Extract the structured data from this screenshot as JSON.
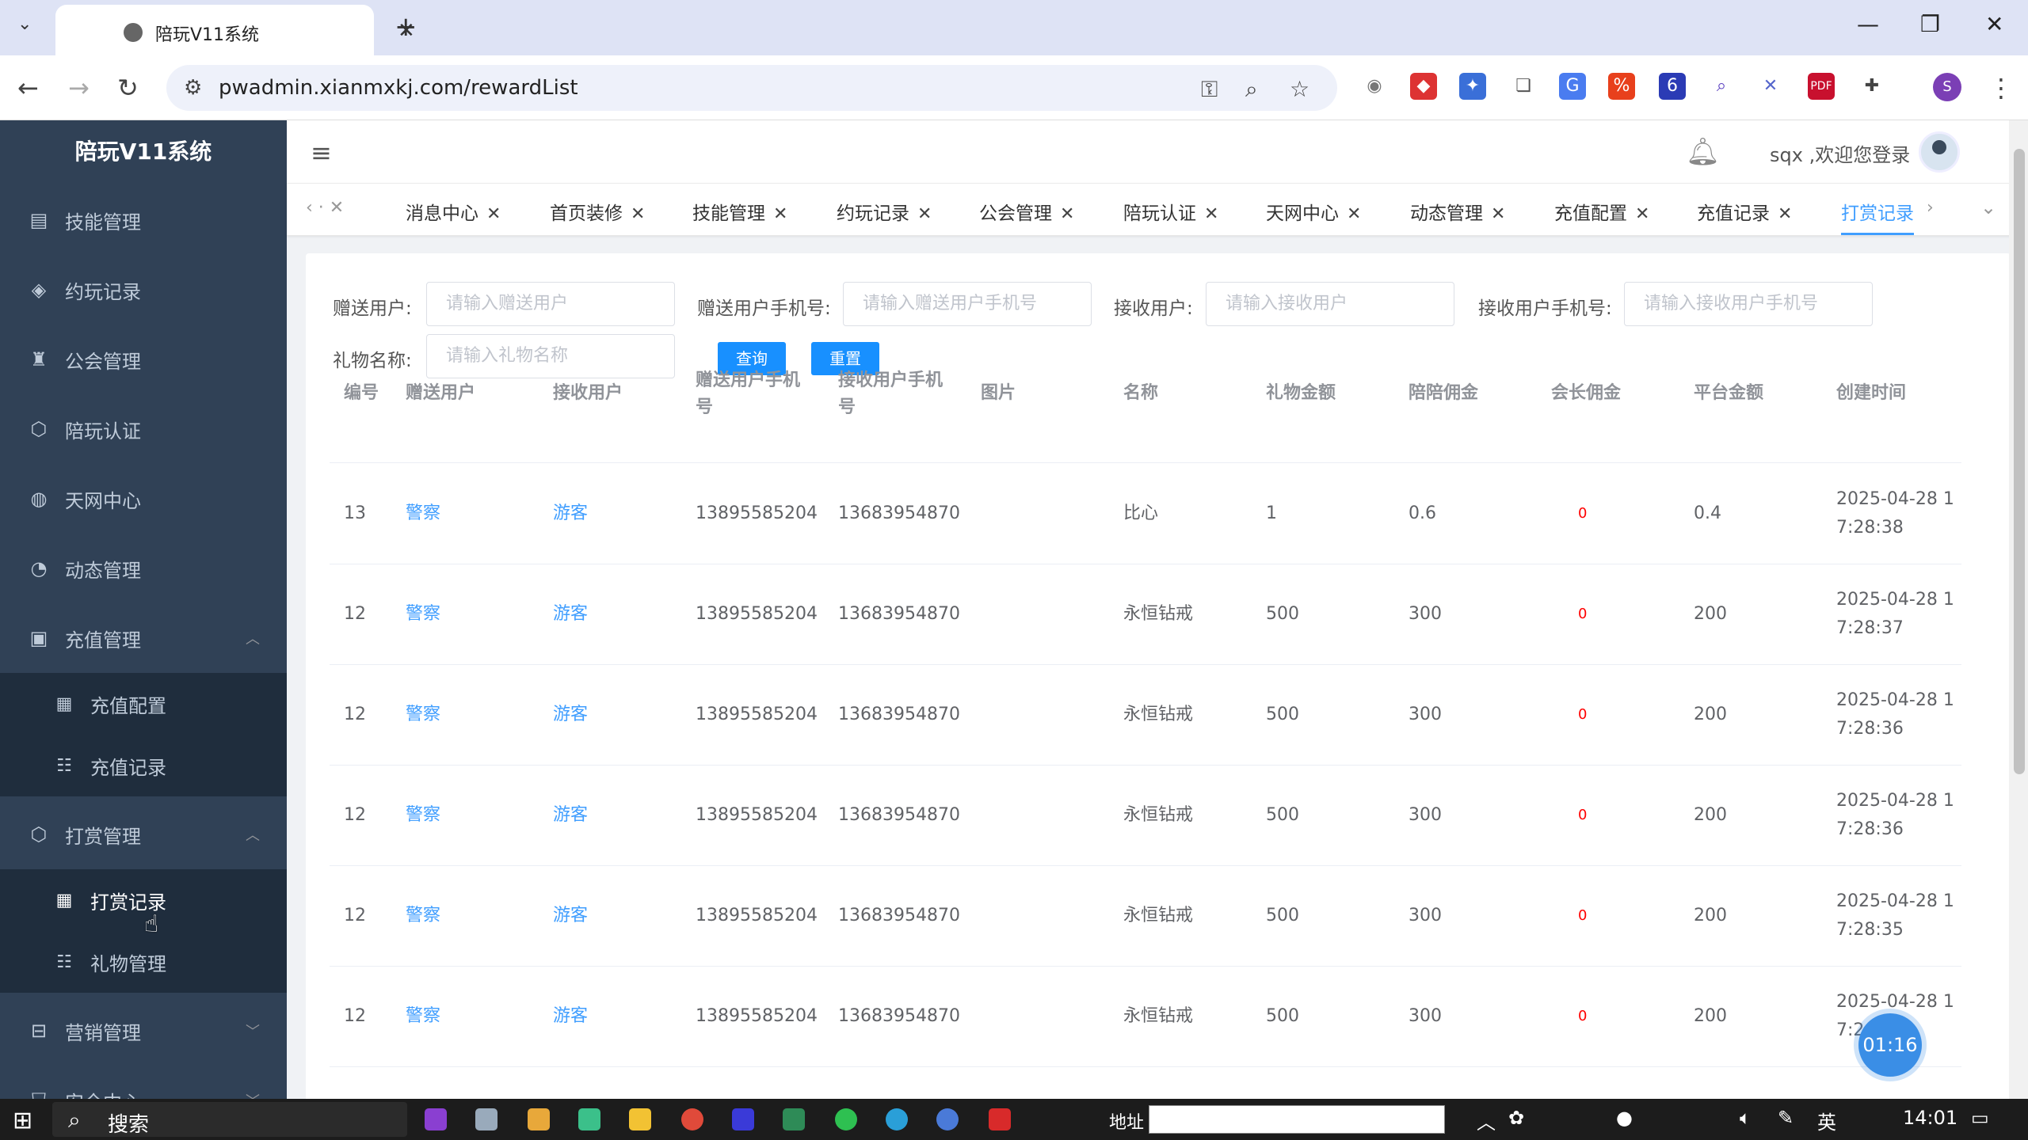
{
  "browser": {
    "tab_title": "陪玩V11系统",
    "url": "pwadmin.xianmxkj.com/rewardList"
  },
  "sidebar": {
    "brand": "陪玩V11系统",
    "items": [
      {
        "label": "技能管理",
        "icon": "clipboard-icon"
      },
      {
        "label": "约玩记录",
        "icon": "layers-icon"
      },
      {
        "label": "公会管理",
        "icon": "user-group-icon"
      },
      {
        "label": "陪玩认证",
        "icon": "box-icon"
      },
      {
        "label": "天网中心",
        "icon": "globe-icon"
      },
      {
        "label": "动态管理",
        "icon": "pie-chart-icon"
      },
      {
        "label": "充值管理",
        "icon": "wallet-icon"
      },
      {
        "label": "充值配置",
        "icon": "table-icon"
      },
      {
        "label": "充值记录",
        "icon": "list-icon"
      },
      {
        "label": "打赏管理",
        "icon": "box-icon"
      },
      {
        "label": "打赏记录",
        "icon": "table-icon"
      },
      {
        "label": "礼物管理",
        "icon": "list-icon"
      },
      {
        "label": "营销管理",
        "icon": "bag-icon"
      },
      {
        "label": "安全中心",
        "icon": "shield-icon"
      }
    ]
  },
  "navbar": {
    "welcome": "sqx ,欢迎您登录"
  },
  "tags": {
    "items": [
      "消息中心",
      "首页装修",
      "技能管理",
      "约玩记录",
      "公会管理",
      "陪玩认证",
      "天网中心",
      "动态管理",
      "充值配置",
      "充值记录",
      "打赏记录"
    ],
    "active": "打赏记录"
  },
  "filters": {
    "sender_label": "赠送用户:",
    "sender_placeholder": "请输入赠送用户",
    "sender_phone_label": "赠送用户手机号:",
    "sender_phone_placeholder": "请输入赠送用户手机号",
    "receiver_label": "接收用户:",
    "receiver_placeholder": "请输入接收用户",
    "receiver_phone_label": "接收用户手机号:",
    "receiver_phone_placeholder": "请输入接收用户手机号",
    "gift_label": "礼物名称:",
    "gift_placeholder": "请输入礼物名称",
    "query_button": "查询",
    "reset_button": "重置"
  },
  "table": {
    "headers": [
      "编号",
      "赠送用户",
      "接收用户",
      "赠送用户手机号",
      "接收用户手机号",
      "图片",
      "名称",
      "礼物金额",
      "陪陪佣金",
      "会长佣金",
      "平台金额",
      "创建时间"
    ],
    "rows": [
      {
        "id": "13",
        "sender": "警察",
        "receiver": "游客",
        "sender_phone": "13895585204",
        "receiver_phone": "13683954870",
        "name": "比心",
        "amount": "1",
        "companion": "0.6",
        "guild": "0",
        "platform": "0.4",
        "time1": "2025-04-28 1",
        "time2": "7:28:38"
      },
      {
        "id": "12",
        "sender": "警察",
        "receiver": "游客",
        "sender_phone": "13895585204",
        "receiver_phone": "13683954870",
        "name": "永恒钻戒",
        "amount": "500",
        "companion": "300",
        "guild": "0",
        "platform": "200",
        "time1": "2025-04-28 1",
        "time2": "7:28:37"
      },
      {
        "id": "12",
        "sender": "警察",
        "receiver": "游客",
        "sender_phone": "13895585204",
        "receiver_phone": "13683954870",
        "name": "永恒钻戒",
        "amount": "500",
        "companion": "300",
        "guild": "0",
        "platform": "200",
        "time1": "2025-04-28 1",
        "time2": "7:28:36"
      },
      {
        "id": "12",
        "sender": "警察",
        "receiver": "游客",
        "sender_phone": "13895585204",
        "receiver_phone": "13683954870",
        "name": "永恒钻戒",
        "amount": "500",
        "companion": "300",
        "guild": "0",
        "platform": "200",
        "time1": "2025-04-28 1",
        "time2": "7:28:36"
      },
      {
        "id": "12",
        "sender": "警察",
        "receiver": "游客",
        "sender_phone": "13895585204",
        "receiver_phone": "13683954870",
        "name": "永恒钻戒",
        "amount": "500",
        "companion": "300",
        "guild": "0",
        "platform": "200",
        "time1": "2025-04-28 1",
        "time2": "7:28:35"
      },
      {
        "id": "12",
        "sender": "警察",
        "receiver": "游客",
        "sender_phone": "13895585204",
        "receiver_phone": "13683954870",
        "name": "永恒钻戒",
        "amount": "500",
        "companion": "300",
        "guild": "0",
        "platform": "200",
        "time1": "2025-04-28 1",
        "time2": "7:2"
      }
    ]
  },
  "overlay": {
    "timer": "01:16"
  },
  "taskbar": {
    "search": "搜索",
    "address_label": "地址",
    "ime": "英",
    "clock": "14:01"
  },
  "colors": {
    "sidebar_bg": "#304156",
    "accent": "#409eff",
    "button": "#1890ff"
  }
}
